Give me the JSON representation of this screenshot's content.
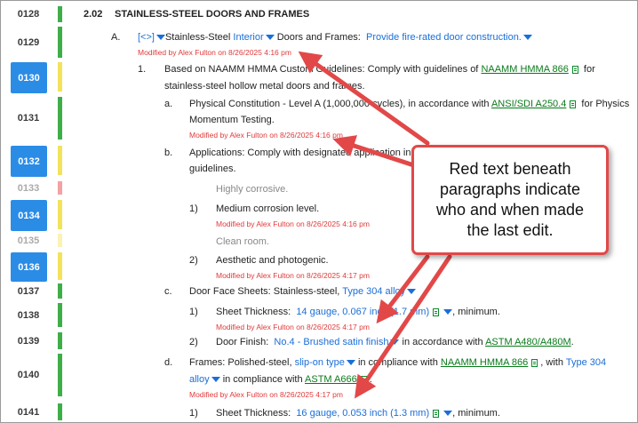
{
  "gutter": [
    {
      "num": "0128",
      "sel": false,
      "dim": false,
      "bar": "g"
    },
    {
      "num": "0129",
      "sel": false,
      "dim": false,
      "bar": "g"
    },
    {
      "num": "0130",
      "sel": true,
      "dim": false,
      "bar": "y"
    },
    {
      "num": "0131",
      "sel": false,
      "dim": false,
      "bar": "g"
    },
    {
      "num": "0132",
      "sel": true,
      "dim": false,
      "bar": "y"
    },
    {
      "num": "0133",
      "sel": false,
      "dim": true,
      "bar": "p"
    },
    {
      "num": "0134",
      "sel": true,
      "dim": false,
      "bar": "y"
    },
    {
      "num": "0135",
      "sel": false,
      "dim": true,
      "bar": "ly"
    },
    {
      "num": "0136",
      "sel": true,
      "dim": false,
      "bar": "y"
    },
    {
      "num": "0137",
      "sel": false,
      "dim": false,
      "bar": "g"
    },
    {
      "num": "0138",
      "sel": false,
      "dim": false,
      "bar": "g"
    },
    {
      "num": "0139",
      "sel": false,
      "dim": false,
      "bar": "g"
    },
    {
      "num": "0140",
      "sel": false,
      "dim": false,
      "bar": "g"
    },
    {
      "num": "0141",
      "sel": false,
      "dim": false,
      "bar": "g"
    }
  ],
  "doc": {
    "article_num": "2.02",
    "article_title": "STAINLESS-STEEL DOORS AND FRAMES",
    "a_label": "A.",
    "a_toggle": "[<>]",
    "a_t1": "Stainless-Steel",
    "a_opt1": "Interior",
    "a_t2": "Doors and Frames:",
    "a_opt2": "Provide fire-rated door construction.",
    "mod_a": "Modified by Alex Fulton on 8/26/2025 4:16 pm",
    "p1_label": "1.",
    "p1_t1": "Based on NAAMM HMMA Custom Guidelines:  Comply with guidelines of",
    "p1_link": "NAAMM HMMA 866",
    "p1_t2": "for",
    "p1_t3": "stainless-steel hollow metal doors and frames.",
    "pa_label": "a.",
    "pa_t1": "Physical Constitution - Level A (1,000,000 cycles), in accordance with",
    "pa_link": "ANSI/SDI A250.4",
    "pa_t2": "for Physics",
    "pa_t3": "Momentum Testing.",
    "mod_pa": "Modified by Alex Fulton on 8/26/2025 4:16 pm",
    "pb_label": "b.",
    "pb_t1": "Applications:  Comply with designated application in accordance with the",
    "pb_t2": "guidelines.",
    "hc": "Highly corrosive.",
    "m1_label": "1)",
    "m1_text": "Medium corrosion level.",
    "mod_m1": "Modified by Alex Fulton on 8/26/2025 4:16 pm",
    "cr": "Clean room.",
    "m2_label": "2)",
    "m2_text": "Aesthetic and photogenic.",
    "mod_m2": "Modified by Alex Fulton on 8/26/2025 4:17 pm",
    "pc_label": "c.",
    "pc_t1": "Door Face Sheets:  Stainless-steel,",
    "pc_opt": "Type 304 alloy",
    "c1_label": "1)",
    "c1_t1": "Sheet Thickness:",
    "c1_opt": "14 gauge, 0.067 inch (1.7 mm)",
    "c1_t2": ", minimum.",
    "mod_c1": "Modified by Alex Fulton on 8/26/2025 4:17 pm",
    "c2_label": "2)",
    "c2_t1": "Door Finish:",
    "c2_opt": "No.4 - Brushed satin finish",
    "c2_t2": "in accordance with",
    "c2_link": "ASTM A480/A480M",
    "c2_t3": ".",
    "pd_label": "d.",
    "pd_t1": "Frames:  Polished-steel,",
    "pd_opt1": "slip-on type",
    "pd_t2": "in compliance with",
    "pd_link1": "NAAMM HMMA 866",
    "pd_t3": ", with",
    "pd_opt2": "Type 304",
    "pd_opt2b": "alloy",
    "pd_t4": "in compliance with",
    "pd_link2": "ASTM A666",
    "pd_t5": ".",
    "mod_pd": "Modified by Alex Fulton on 8/26/2025 4:17 pm",
    "d1_label": "1)",
    "d1_t1": "Sheet Thickness:",
    "d1_opt": "16 gauge, 0.053 inch (1.3 mm)",
    "d1_t2": ", minimum."
  },
  "callout": {
    "text": "Red text beneath paragraphs indicate who and when made the last edit."
  },
  "colors": {
    "arrow": "#e24848",
    "accent": "#2b8ce6",
    "link": "#0a7a1a",
    "option": "#1a6ed8",
    "modified": "#e03a3a"
  }
}
